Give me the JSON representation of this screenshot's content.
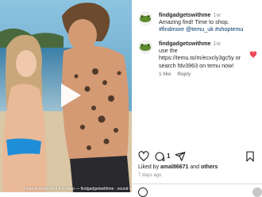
{
  "media": {
    "watermark_text": "Original audio from the video — findgadgetswithme · sound on / share",
    "play_icon": "play-icon"
  },
  "comments": [
    {
      "username": "findgadgetswithme",
      "time": "1w",
      "text_prefix": "Amazing find! Time to shop. ",
      "hashtag1": "#findmore",
      "mention": "@temu_uk",
      "hashtag2": "#shoptemu"
    },
    {
      "username": "findgadgetswithme",
      "time": "1w",
      "text": "use the https://temu.to/m/ecxcly3gc5y or search fdv3963 on temu now!",
      "likes": "1 like",
      "reply_label": "Reply"
    }
  ],
  "actions": {
    "like_icon": "heart-icon",
    "comment_icon": "comment-icon",
    "comment_count": "1",
    "share_icon": "share-icon",
    "save_icon": "bookmark-icon"
  },
  "liked_by": {
    "prefix": "Liked by ",
    "user": "amal86671",
    "suffix_mid": " and ",
    "others": "others"
  },
  "post_date": "7 days ago",
  "colors": {
    "text": "#262626",
    "muted": "#8e8e8e",
    "link": "#00376b",
    "heart_red": "#ed4956"
  }
}
